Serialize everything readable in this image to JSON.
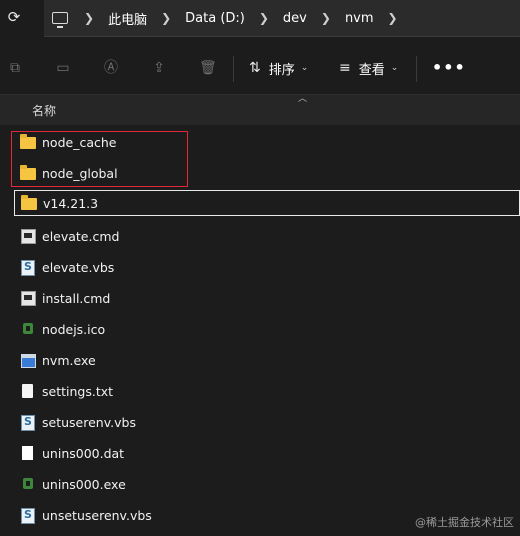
{
  "address_bar": {
    "refresh_icon": "refresh-icon",
    "pc_icon": "this-pc-icon",
    "crumbs": [
      "此电脑",
      "Data (D:)",
      "dev",
      "nvm"
    ]
  },
  "toolbar": {
    "sort_label": "排序",
    "view_label": "查看",
    "more_label": "•••"
  },
  "header": {
    "name_col": "名称"
  },
  "files": [
    {
      "name": "node_cache",
      "type": "folder"
    },
    {
      "name": "node_global",
      "type": "folder"
    },
    {
      "name": "v14.21.3",
      "type": "folder"
    },
    {
      "name": "elevate.cmd",
      "type": "cmd"
    },
    {
      "name": "elevate.vbs",
      "type": "vbs"
    },
    {
      "name": "install.cmd",
      "type": "cmd"
    },
    {
      "name": "nodejs.ico",
      "type": "ico"
    },
    {
      "name": "nvm.exe",
      "type": "exe"
    },
    {
      "name": "settings.txt",
      "type": "txt"
    },
    {
      "name": "setuserenv.vbs",
      "type": "vbs"
    },
    {
      "name": "unins000.dat",
      "type": "dat"
    },
    {
      "name": "unins000.exe",
      "type": "exe-node"
    },
    {
      "name": "unsetuserenv.vbs",
      "type": "vbs"
    }
  ],
  "watermark": "@稀土掘金技术社区",
  "colors": {
    "background": "#1c1c1c",
    "highlight_box": "#e0283a",
    "folder": "#f5c542"
  }
}
